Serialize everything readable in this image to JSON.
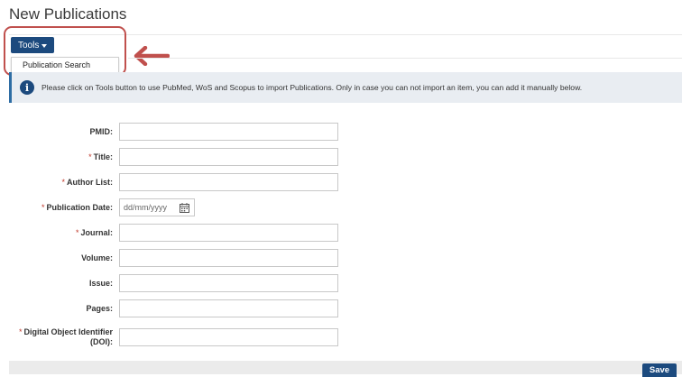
{
  "page": {
    "title": "New Publications"
  },
  "toolbar": {
    "tools_label": "Tools",
    "dropdown_items": [
      {
        "label": "Publication Search"
      }
    ]
  },
  "info": {
    "message": "Please click on Tools button to use PubMed, WoS and Scopus to import Publications. Only in case you can not import an item, you can add it manually below."
  },
  "form": {
    "required_marker": "*",
    "fields": [
      {
        "label": "PMID:",
        "required": false,
        "value": ""
      },
      {
        "label": "Title:",
        "required": true,
        "value": ""
      },
      {
        "label": "Author List:",
        "required": true,
        "value": ""
      },
      {
        "label": "Publication Date:",
        "required": true,
        "placeholder": "dd/mm/yyyy"
      },
      {
        "label": "Journal:",
        "required": true,
        "value": ""
      },
      {
        "label": "Volume:",
        "required": false,
        "value": ""
      },
      {
        "label": "Issue:",
        "required": false,
        "value": ""
      },
      {
        "label": "Pages:",
        "required": false,
        "value": ""
      },
      {
        "label_line1": "Digital Object Identifier",
        "label_line2": "(DOI):",
        "required": true,
        "value": ""
      }
    ]
  },
  "footer": {
    "save_label": "Save"
  },
  "colors": {
    "primary": "#1c4a7e",
    "highlight": "#c0504d",
    "required": "#c0392b",
    "info_bg": "#e9edf2"
  },
  "icons": {
    "info": "info-icon",
    "calendar": "calendar-icon",
    "arrow": "arrow-left-icon",
    "caret": "caret-down-icon"
  }
}
